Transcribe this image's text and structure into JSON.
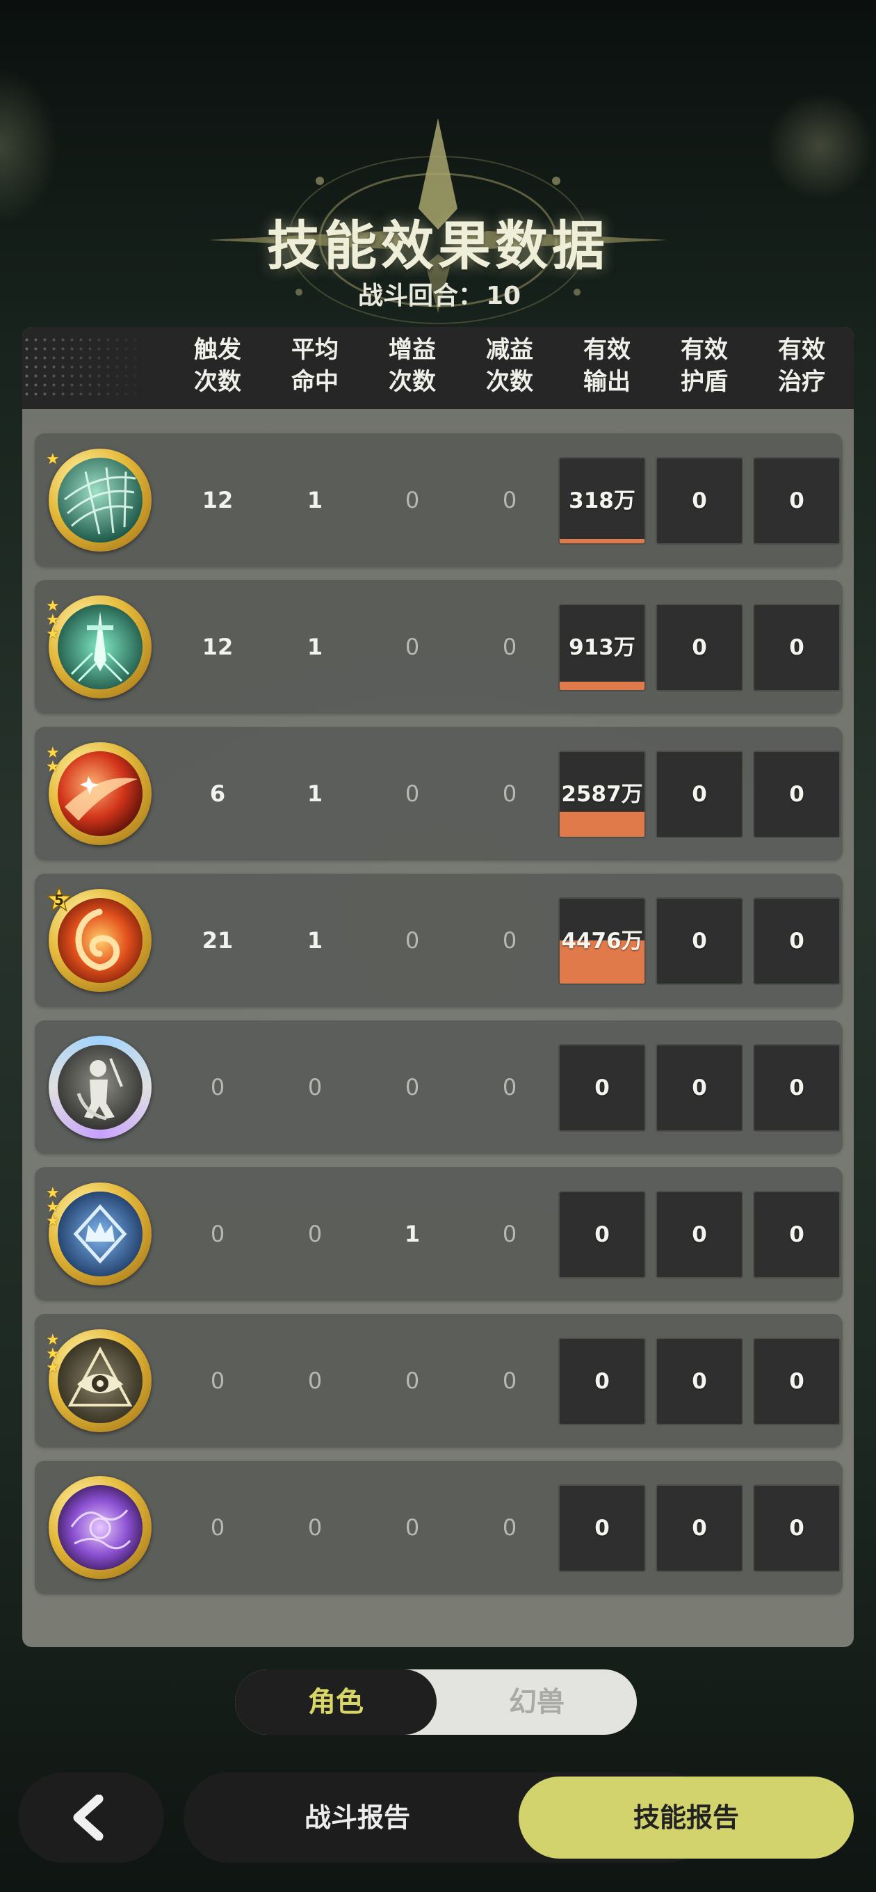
{
  "header": {
    "title": "技能效果数据",
    "rounds_label": "战斗回合：",
    "rounds_value": "10"
  },
  "columns": [
    {
      "line1": "触发",
      "line2": "次数"
    },
    {
      "line1": "平均",
      "line2": "命中"
    },
    {
      "line1": "增益",
      "line2": "次数"
    },
    {
      "line1": "减益",
      "line2": "次数"
    },
    {
      "line1": "有效",
      "line2": "输出"
    },
    {
      "line1": "有效",
      "line2": "护盾"
    },
    {
      "line1": "有效",
      "line2": "治疗"
    }
  ],
  "rows": [
    {
      "icon": "web-skill-icon",
      "stars": 1,
      "level": "",
      "trigger": "12",
      "hit": "1",
      "buff": "0",
      "debuff": "0",
      "output": "318万",
      "output_fill": 0.07,
      "shield": "0",
      "heal": "0"
    },
    {
      "icon": "sword-skill-icon",
      "stars": 3,
      "level": "",
      "trigger": "12",
      "hit": "1",
      "buff": "0",
      "debuff": "0",
      "output": "913万",
      "output_fill": 0.2,
      "shield": "0",
      "heal": "0"
    },
    {
      "icon": "slash-fire-skill-icon",
      "stars": 2,
      "level": "",
      "trigger": "6",
      "hit": "1",
      "buff": "0",
      "debuff": "0",
      "output": "2587万",
      "output_fill": 0.58,
      "shield": "0",
      "heal": "0"
    },
    {
      "icon": "fire-swirl-skill-icon",
      "stars": 0,
      "level": "5",
      "trigger": "21",
      "hit": "1",
      "buff": "0",
      "debuff": "0",
      "output": "4476万",
      "output_fill": 1.0,
      "shield": "0",
      "heal": "0"
    },
    {
      "icon": "warrior-skill-icon",
      "stars": 0,
      "level": "",
      "trigger": "0",
      "hit": "0",
      "buff": "0",
      "debuff": "0",
      "output": "0",
      "output_fill": 0,
      "shield": "0",
      "heal": "0"
    },
    {
      "icon": "crown-skill-icon",
      "stars": 3,
      "level": "",
      "trigger": "0",
      "hit": "0",
      "buff": "1",
      "debuff": "0",
      "output": "0",
      "output_fill": 0,
      "shield": "0",
      "heal": "0"
    },
    {
      "icon": "eye-skill-icon",
      "stars": 3,
      "level": "",
      "trigger": "0",
      "hit": "0",
      "buff": "0",
      "debuff": "0",
      "output": "0",
      "output_fill": 0,
      "shield": "0",
      "heal": "0"
    },
    {
      "icon": "purple-orb-skill-icon",
      "stars": 0,
      "level": "",
      "trigger": "0",
      "hit": "0",
      "buff": "0",
      "debuff": "0",
      "output": "0",
      "output_fill": 0,
      "shield": "0",
      "heal": "0"
    }
  ],
  "toggle": {
    "active": "角色",
    "inactive": "幻兽"
  },
  "bottom": {
    "back_icon": "chevron-left-icon",
    "report_label": "战斗报告",
    "skill_label": "技能报告"
  },
  "colors": {
    "accent": "#d2d36c",
    "output_bar": "#e07a4a",
    "toggle_active_text": "#d8d667"
  }
}
